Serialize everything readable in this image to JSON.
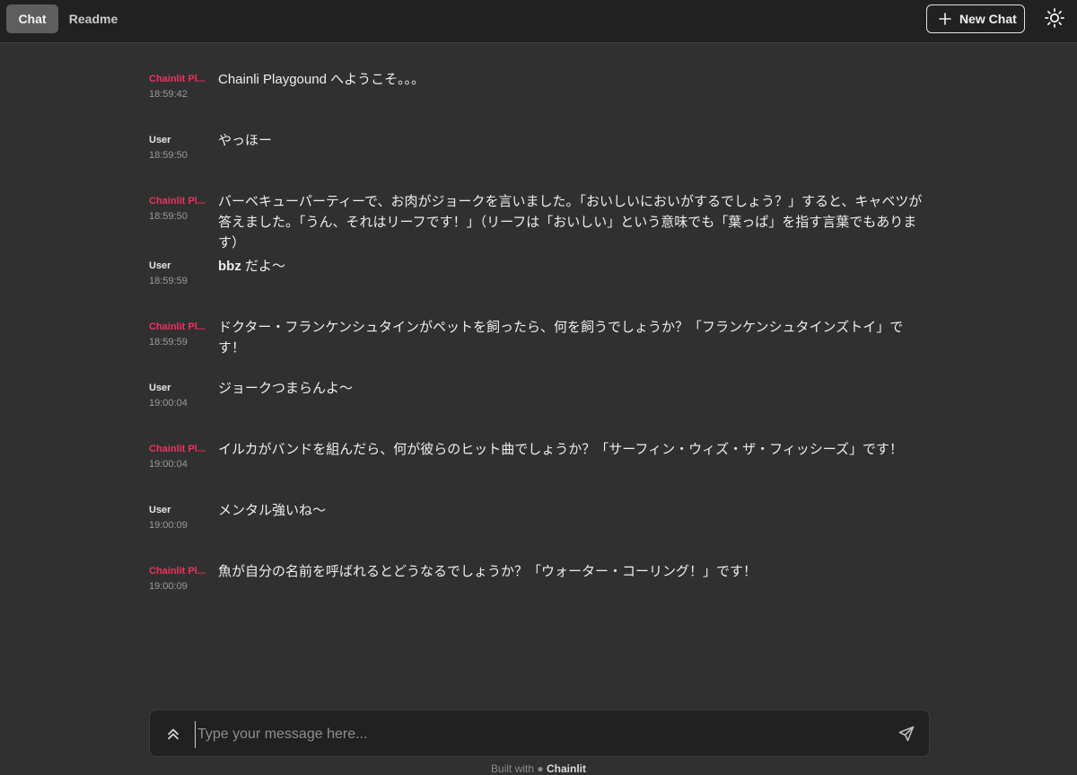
{
  "header": {
    "tabs": [
      {
        "label": "Chat",
        "active": true
      },
      {
        "label": "Readme",
        "active": false
      }
    ],
    "new_chat_label": "New Chat",
    "new_chat_icon": "plus-icon",
    "theme_icon": "sun-icon"
  },
  "colors": {
    "background": "#303030",
    "topbar": "#212121",
    "bot_author": "#f1315f",
    "active_tab": "#5e5e5e"
  },
  "messages": [
    {
      "author": "Chainlit Pl...",
      "role": "bot",
      "time": "18:59:42",
      "text": "Chainli Playgound へようこそ。。。"
    },
    {
      "author": "User",
      "role": "user",
      "time": "18:59:50",
      "text": "やっほー"
    },
    {
      "author": "Chainlit Pl...",
      "role": "bot",
      "time": "18:59:50",
      "text": "バーベキューパーティーで、お肉がジョークを言いました。「おいしいにおいがするでしょう？」すると、キャベツが答えました。「うん、それはリーフです！」（リーフは「おいしい」という意味でも「葉っぱ」を指す言葉でもあります）"
    },
    {
      "author": "User",
      "role": "user",
      "time": "18:59:59",
      "text_bold": "bbz",
      "text": " だよ〜"
    },
    {
      "author": "Chainlit Pl...",
      "role": "bot",
      "time": "18:59:59",
      "text": "ドクター・フランケンシュタインがペットを飼ったら、何を飼うでしょうか？「フランケンシュタインズトイ」です！"
    },
    {
      "author": "User",
      "role": "user",
      "time": "19:00:04",
      "text": "ジョークつまらんよ〜"
    },
    {
      "author": "Chainlit Pl...",
      "role": "bot",
      "time": "19:00:04",
      "text": "イルカがバンドを組んだら、何が彼らのヒット曲でしょうか？「サーフィン・ウィズ・ザ・フィッシーズ」です！"
    },
    {
      "author": "User",
      "role": "user",
      "time": "19:00:09",
      "text": "メンタル強いね〜"
    },
    {
      "author": "Chainlit Pl...",
      "role": "bot",
      "time": "19:00:09",
      "text": "魚が自分の名前を呼ばれるとどうなるでしょうか？「ウォーター・コーリング！」です！"
    }
  ],
  "composer": {
    "placeholder": "Type your message here...",
    "expand_icon": "chevrons-up-icon",
    "send_icon": "send-icon"
  },
  "footer": {
    "prefix": "Built with",
    "brand": "Chainlit"
  }
}
